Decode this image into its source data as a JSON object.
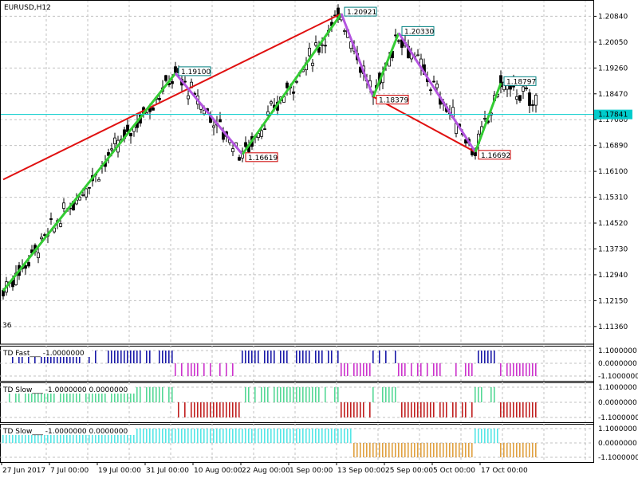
{
  "chart_data": {
    "type": "line",
    "title": "EURUSD,H12",
    "price_axis_ticks": [
      "1.20840",
      "1.20050",
      "1.19260",
      "1.18470",
      "1.17680",
      "1.16890",
      "1.16100",
      "1.15310",
      "1.14520",
      "1.13730",
      "1.12940",
      "1.12150",
      "1.11360"
    ],
    "price_range": [
      1.1082,
      1.2124
    ],
    "current_price": 1.1784,
    "current_price_label": "1.17841",
    "time_axis_labels": [
      "27 Jun 2017",
      "7 Jul 00:00",
      "19 Jul 00:00",
      "31 Jul 00:00",
      "10 Aug 00:00",
      "22 Aug 00:00",
      "1 Sep 00:00",
      "13 Sep 00:00",
      "25 Sep 00:00",
      "5 Oct 00:00",
      "17 Oct 00:00"
    ],
    "edge_label": "36",
    "zigzag_fast": [
      {
        "bar": 0,
        "price": 1.1245
      },
      {
        "bar": 54,
        "price": 1.191,
        "label": "1.19100",
        "label_pos": "above"
      },
      {
        "bar": 75,
        "price": 1.16619,
        "label": "1.16619",
        "label_pos": "below"
      },
      {
        "bar": 106,
        "price": 1.20921,
        "label": "1.20921",
        "label_pos": "above"
      },
      {
        "bar": 116,
        "price": 1.18379,
        "label": "1.18379",
        "label_pos": "below"
      },
      {
        "bar": 124,
        "price": 1.2033,
        "label": "1.20330",
        "label_pos": "above"
      },
      {
        "bar": 148,
        "price": 1.16692,
        "label": "1.16692",
        "label_pos": "below"
      },
      {
        "bar": 156,
        "price": 1.18797,
        "label": "1.18797",
        "label_pos": "above"
      }
    ],
    "zigzag_slow": [
      {
        "bar": 0,
        "price": 1.1585
      },
      {
        "bar": 106,
        "price": 1.20921
      },
      {
        "bar": 116,
        "price": 1.18379
      },
      {
        "bar": 148,
        "price": 1.16692
      }
    ],
    "colors": {
      "candle": "#000000",
      "zigzag_up": "#33cc33",
      "zigzag_down": "#b455e0",
      "zigzag_slow": "#e01010",
      "current_price_line": "#00cccc",
      "label_high": "#008080",
      "label_low": "#cc0000",
      "grid": "#c0c0c0",
      "td_fast_up": "#1a1aa8",
      "td_fast_down": "#cc33cc",
      "td_slow1_up": "#55d896",
      "td_slow1_down": "#c02020",
      "td_slow2_up": "#55e6e6",
      "td_slow2_down": "#e0a040"
    },
    "indicators": [
      {
        "label": "TD Fast___ -1.0000000",
        "ticks": [
          "1.1000000",
          "0.0000000",
          "-1.1000000"
        ],
        "up_color": "td_fast_up",
        "down_color": "td_fast_down"
      },
      {
        "label": "TD Slow___ -1.0000000 0.0000000",
        "ticks": [
          "1.1000000",
          "0.0000000",
          "-1.1000000"
        ],
        "up_color": "td_slow1_up",
        "down_color": "td_slow1_down"
      },
      {
        "label": "TD Slow___ -1.0000000 0.0000000",
        "ticks": [
          "1.1000000",
          "0.0000000",
          "-1.1000000"
        ],
        "up_color": "td_slow2_up",
        "down_color": "td_slow2_down"
      }
    ]
  }
}
